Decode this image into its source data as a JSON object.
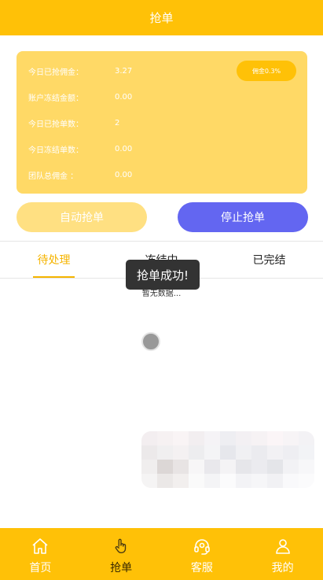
{
  "header": {
    "title": "抢单"
  },
  "stats": {
    "badge": "佣金0.3%",
    "rows": [
      {
        "label": "今日已抢佣金：",
        "value": "3.27"
      },
      {
        "label": "账户冻结金额：",
        "value": "0.00"
      },
      {
        "label": "今日已抢单数：",
        "value": "2"
      },
      {
        "label": "今日冻结单数：",
        "value": "0.00"
      },
      {
        "label": "团队总佣金 ：",
        "value": "0.00"
      }
    ]
  },
  "buttons": {
    "auto": "自动抢单",
    "stop": "停止抢单"
  },
  "tabs": [
    {
      "label": "待处理"
    },
    {
      "label": "冻结中"
    },
    {
      "label": "已完结"
    }
  ],
  "empty_text": "暂无数据...",
  "toast": "抢单成功!",
  "tabbar": [
    {
      "label": "首页",
      "icon": "home-icon"
    },
    {
      "label": "抢单",
      "icon": "hand-pointer-icon"
    },
    {
      "label": "客服",
      "icon": "headset-icon"
    },
    {
      "label": "我的",
      "icon": "user-icon"
    }
  ],
  "colors": {
    "primary": "#FFC107",
    "card": "#FFD966",
    "stop": "#6366F1",
    "active_tab": "#F5B400"
  }
}
